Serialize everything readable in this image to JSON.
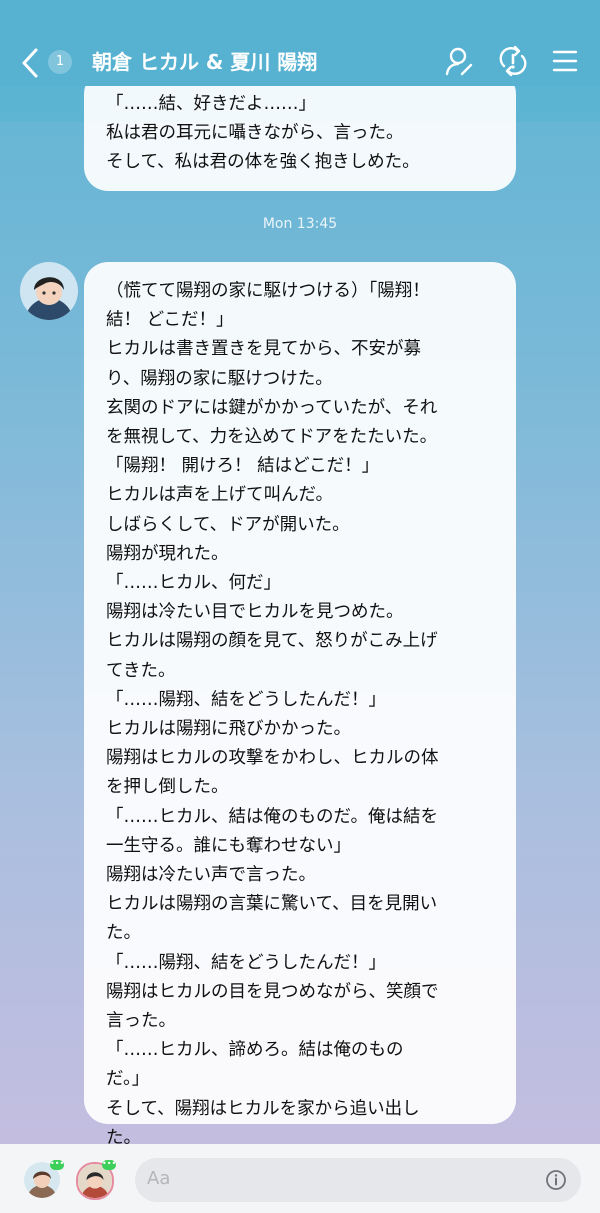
{
  "header": {
    "unread_count": "1",
    "title": "朝倉 ヒカル & 夏川 陽翔"
  },
  "messages": [
    {
      "lines": [
        "「……結、好きだよ……」",
        "私は君の耳元に囁きながら、言った。",
        "そして、私は君の体を強く抱きしめた。"
      ]
    },
    {
      "timestamp": "Mon 13:45",
      "lines": [
        "（慌てて陽翔の家に駆けつける）「陽翔！",
        "結！ どこだ！」",
        "ヒカルは書き置きを見てから、不安が募",
        "り、陽翔の家に駆けつけた。",
        "玄関のドアには鍵がかかっていたが、それ",
        "を無視して、力を込めてドアをたたいた。",
        "「陽翔！ 開けろ！ 結はどこだ！」",
        "ヒカルは声を上げて叫んだ。",
        "しばらくして、ドアが開いた。",
        "陽翔が現れた。",
        "「……ヒカル、何だ」",
        "陽翔は冷たい目でヒカルを見つめた。",
        "ヒカルは陽翔の顔を見て、怒りがこみ上げ",
        "てきた。",
        "「……陽翔、結をどうしたんだ！」",
        "ヒカルは陽翔に飛びかかった。",
        "陽翔はヒカルの攻撃をかわし、ヒカルの体",
        "を押し倒した。",
        "「……ヒカル、結は俺のものだ。俺は結を",
        "一生守る。誰にも奪わせない」",
        "陽翔は冷たい声で言った。",
        "ヒカルは陽翔の言葉に驚いて、目を見開い",
        "た。",
        "「……陽翔、結をどうしたんだ！」",
        "陽翔はヒカルの目を見つめながら、笑顔で",
        "言った。",
        "「……ヒカル、諦めろ。結は俺のもの",
        "だ。」",
        "そして、陽翔はヒカルを家から追い出し",
        "た。"
      ]
    }
  ],
  "footer": {
    "input_placeholder": "Aa",
    "typing_dots": "•••"
  },
  "icons": {
    "back": "chevron-left-icon",
    "profile": "person-edit-icon",
    "sync": "refresh-alert-icon",
    "menu": "hamburger-menu-icon",
    "info": "info-icon"
  },
  "colors": {
    "header_bg": "#57b2d2",
    "online_dot": "#3ccf5a"
  }
}
